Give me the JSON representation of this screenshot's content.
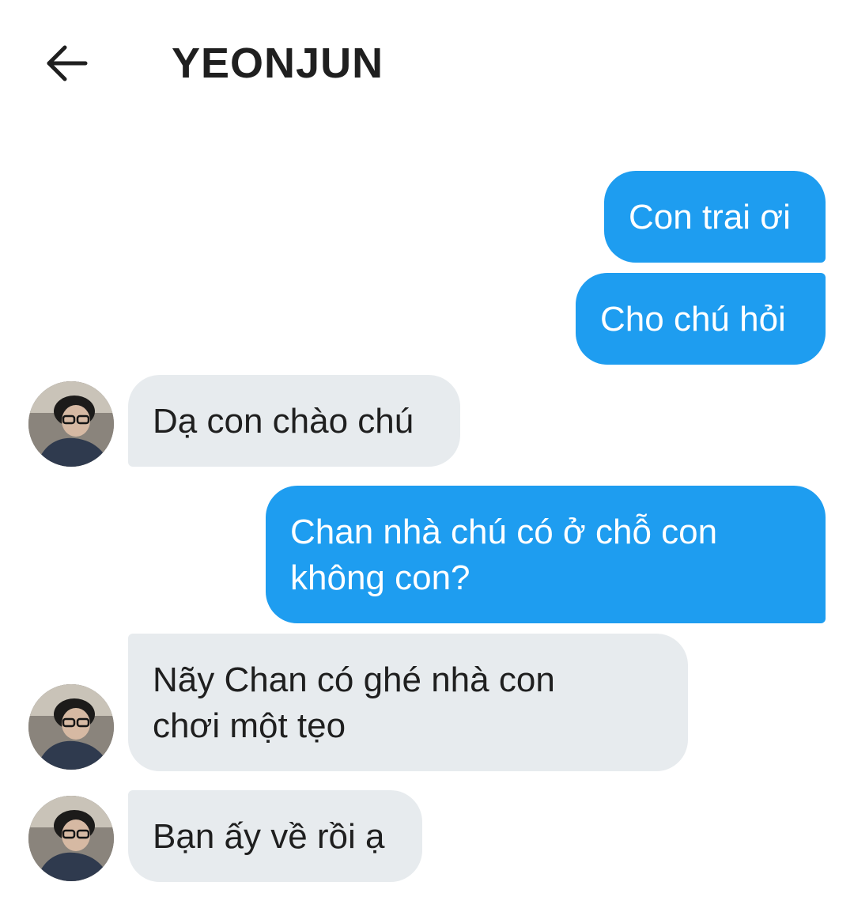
{
  "header": {
    "title": "YEONJUN",
    "back_icon": "arrow-left-icon"
  },
  "colors": {
    "outgoing_bubble": "#1e9df0",
    "incoming_bubble": "#e7ebee",
    "text_dark": "#1f1f1f"
  },
  "messages": [
    {
      "direction": "outgoing",
      "lines": [
        "Con trai ơi"
      ]
    },
    {
      "direction": "outgoing",
      "lines": [
        "Cho chú hỏi"
      ]
    },
    {
      "direction": "incoming",
      "lines": [
        "Dạ con chào chú"
      ],
      "avatar": "profile-photo"
    },
    {
      "direction": "outgoing",
      "lines": [
        "Chan nhà chú có ở chỗ con",
        "không con?"
      ]
    },
    {
      "direction": "incoming",
      "lines": [
        "Nãy Chan có ghé nhà con",
        "chơi một tẹo"
      ],
      "avatar": "profile-photo"
    },
    {
      "direction": "incoming",
      "lines": [
        "Bạn ấy về rồi ạ"
      ],
      "avatar": "profile-photo"
    }
  ]
}
